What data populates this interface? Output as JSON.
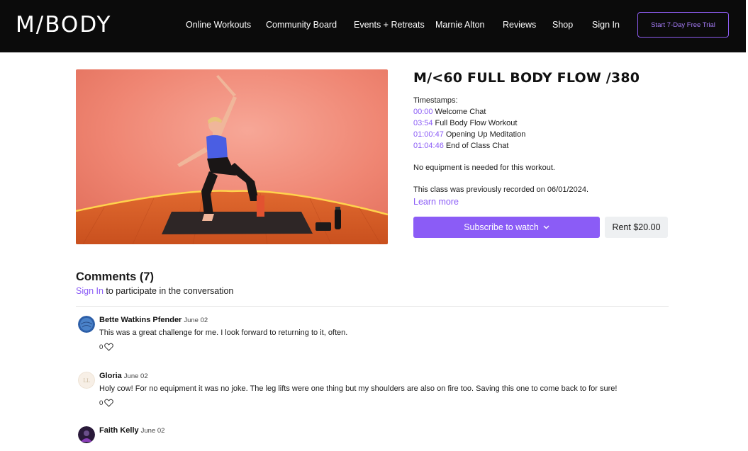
{
  "header": {
    "logo": "M/BODY",
    "nav": [
      "Online Workouts",
      "Community Board",
      "Events + Retreats",
      "Marnie Alton",
      "Reviews",
      "Shop",
      "Sign In"
    ],
    "cta": "Start 7-Day Free Trial"
  },
  "colors": {
    "accent": "#8b5cf6",
    "header_bg": "#0b0b0b",
    "thumb_wall": "#f08a7a",
    "thumb_floor": "#d9612c"
  },
  "video": {
    "icon": "workout-thumbnail-image"
  },
  "class": {
    "title": "M/<60 FULL BODY FLOW /380",
    "timestamps_label": "Timestamps:",
    "timestamps": [
      {
        "time": "00:00",
        "label": "Welcome Chat"
      },
      {
        "time": "03:54",
        "label": "Full Body Flow Workout"
      },
      {
        "time": "01:00:47",
        "label": "Opening Up Meditation"
      },
      {
        "time": "01:04:46",
        "label": "End of Class Chat"
      }
    ],
    "equipment": "No equipment is needed for this workout.",
    "recorded": "This class was previously recorded on 06/01/2024.",
    "learn_more": "Learn more",
    "subscribe": "Subscribe to watch",
    "subscribe_icon": "chevron-down-icon",
    "rent": "Rent $20.00"
  },
  "comments": {
    "title": "Comments (7)",
    "signin_link": "Sign In",
    "signin_text": " to participate in the conversation",
    "like_icon": "heart-icon",
    "items": [
      {
        "author": "Bette Watkins Pfender",
        "date": "June 02",
        "text": "This was a great challenge for me. I look forward to returning to it, often.",
        "likes": "0"
      },
      {
        "author": "Gloria",
        "date": "June 02",
        "text": "Holy cow! For no equipment it was no joke. The leg lifts were one thing but my shoulders are also on fire too. Saving this one to come back to for sure!",
        "likes": "0"
      },
      {
        "author": "Faith Kelly",
        "date": "June 02",
        "text": "",
        "likes": ""
      }
    ]
  }
}
